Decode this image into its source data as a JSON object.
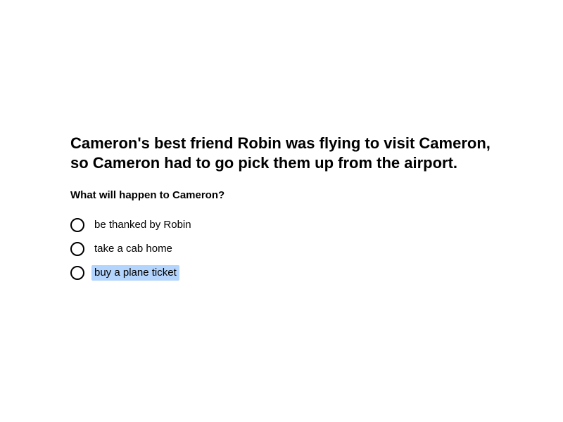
{
  "passage": "Cameron's best friend Robin was flying to visit Cameron, so Cameron had to go pick them up from the airport.",
  "question": "What will happen to Cameron?",
  "options": [
    {
      "label": "be thanked by Robin",
      "highlighted": false
    },
    {
      "label": "take a cab home",
      "highlighted": false
    },
    {
      "label": "buy a plane ticket",
      "highlighted": true
    }
  ],
  "colors": {
    "text": "#000000",
    "background": "#ffffff",
    "highlight": "#b3d4fc"
  },
  "icons": {
    "radio": "radio-button-unchecked-icon"
  }
}
